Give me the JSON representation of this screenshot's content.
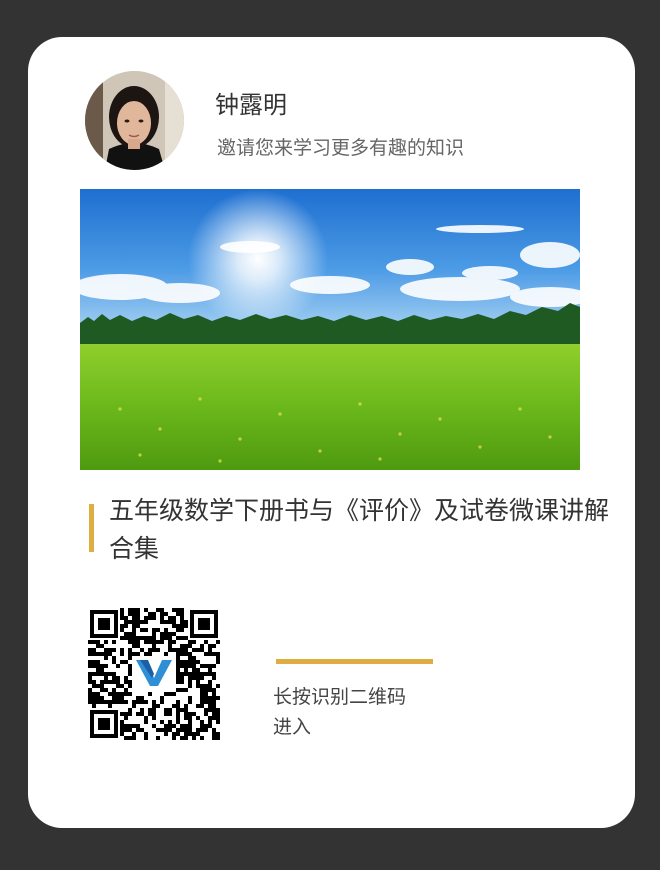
{
  "profile": {
    "name": "钟露明",
    "invite_text": "邀请您来学习更多有趣的知识"
  },
  "banner": {
    "icon": "landscape-photo-meadow-sky"
  },
  "course": {
    "title": "五年级数学下册书与《评价》及试卷微课讲解合集"
  },
  "qr": {
    "icon": "qr-code-icon",
    "hint_line1": "长按识别二维码",
    "hint_line2": "进入"
  },
  "colors": {
    "background": "#333333",
    "card": "#ffffff",
    "accent": "#dfae42"
  }
}
